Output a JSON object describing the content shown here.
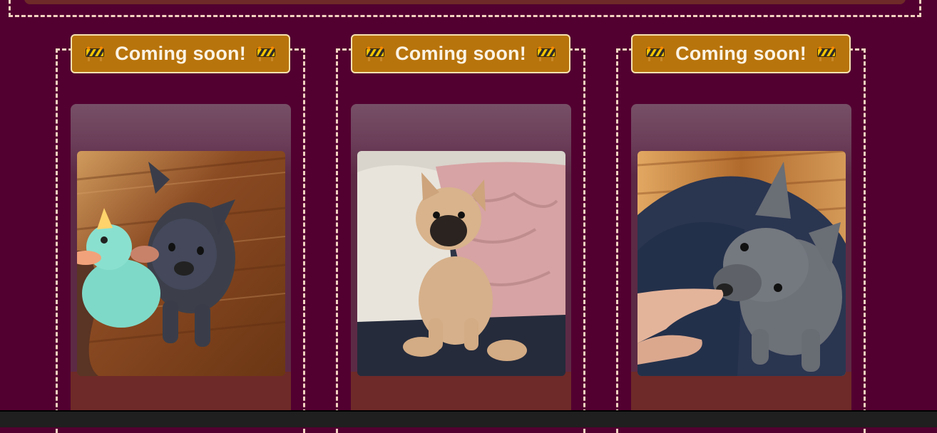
{
  "cards": [
    {
      "badge_label": "Coming soon!",
      "badge_icon_left": "construction-sign-icon",
      "badge_icon_right": "construction-sign-icon",
      "photo_subject": "blue french bulldog puppy with toy unicorn duck on wooden floor"
    },
    {
      "badge_label": "Coming soon!",
      "badge_icon_left": "construction-sign-icon",
      "badge_icon_right": "construction-sign-icon",
      "photo_subject": "fawn french bulldog puppy sitting on couch cushions"
    },
    {
      "badge_label": "Coming soon!",
      "badge_icon_left": "construction-sign-icon",
      "badge_icon_right": "construction-sign-icon",
      "photo_subject": "blue french bulldog puppy on lap licking finger"
    }
  ],
  "colors": {
    "page_background": "#520030",
    "badge_background": "#b8740c",
    "dashed_border": "#f3d2c0",
    "card_footer": "#6e2a28"
  }
}
